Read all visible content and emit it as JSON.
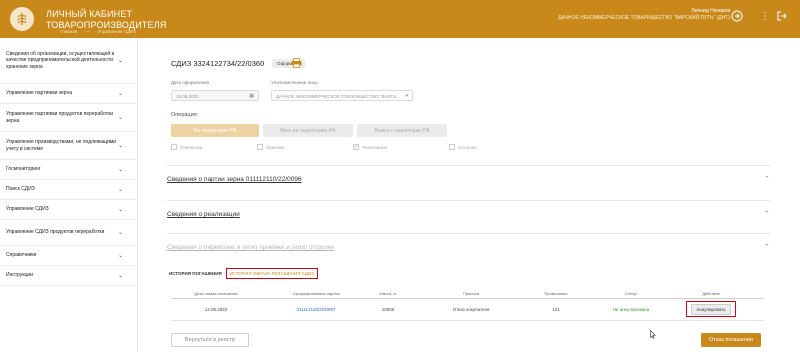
{
  "header": {
    "title_line1": "ЛИЧНЫЙ КАБИНЕТ",
    "title_line2": "ТОВАРОПРОИЗВОДИТЕЛЯ",
    "user_name": "Леонид Начаров",
    "user_org": "ДАЧНОЕ НЕКОММЕРЧЕСКОЕ ТОВАРИЩЕСТВО \"ВАРСКИЙ ПУТЬ\" (ДНТ)",
    "breadcrumb": [
      "Главная",
      "Управление СДИЗ"
    ]
  },
  "sidebar": {
    "items": [
      {
        "label": "Сведения об организации, осуществляющей в качестве предпринимательской деятельности хранение зерна"
      },
      {
        "label": "Управление партиями зерна"
      },
      {
        "label": "Управление партиями продуктов переработки зерна"
      },
      {
        "label": "Управление производствами, не подлежащими учету в системе"
      },
      {
        "label": "Госмониторинг"
      },
      {
        "label": "Поиск СДИЗ"
      },
      {
        "label": "Управление СДИЗ"
      },
      {
        "label": "Управление СДИЗ продуктов переработки"
      },
      {
        "label": "Справочники"
      },
      {
        "label": "Инструкции"
      }
    ]
  },
  "doc": {
    "title": "СДИЗ 3324122734/22/0360",
    "status": "Оформлен",
    "date_label": "Дата оформления",
    "date_value": "15.09.2022",
    "org_label": "Уполномоченное лицо",
    "org_value": "ДАЧНОЕ НЕКОММЕРЧЕСКОЕ ТОВАРИЩЕСТВО \"ВАРСК...",
    "operation_label": "Операция:",
    "operations": [
      "На территории РФ",
      "Ввоз на территорию РФ",
      "Вывоз с территории РФ"
    ],
    "checkboxes": [
      {
        "label": "Перевозка",
        "checked": false
      },
      {
        "label": "Приемка",
        "checked": false
      },
      {
        "label": "Реализация",
        "checked": true
      },
      {
        "label": "Отгрузка",
        "checked": false
      }
    ]
  },
  "sections": [
    {
      "title": "Сведения о партии зерна 011112110/22/0096"
    },
    {
      "title": "Сведения о реализации"
    },
    {
      "title": "Сведения о перевозке и (или) приемке и (или) отгрузке"
    }
  ],
  "history": {
    "tab_label": "ИСТОРИЯ ПОГАШЕНИЯ",
    "tab_highlight": "ИСТОРИЯ ОБРАЗА ПОГАШЕНИЯ СДИЗ",
    "columns": [
      "Дата отказа погашения",
      "Сформированная партия",
      "Масса, кг",
      "Причина",
      "Примечание",
      "Статус",
      "Действие"
    ],
    "rows": [
      {
        "date": "14.09.2022",
        "batch": "011112110/22/0097",
        "mass": "10000",
        "reason": "Отказ покупателя",
        "note": "121",
        "status": "Не аннулирована",
        "action": "Аннулировать"
      }
    ]
  },
  "footer": {
    "back_label": "Вернуться в реестр",
    "cancel_label": "Отказ погашения"
  },
  "colors": {
    "brand": "#c8891a",
    "highlight": "#d0021b",
    "link": "#2a6fbf",
    "status_ok": "#3a9b3a"
  }
}
